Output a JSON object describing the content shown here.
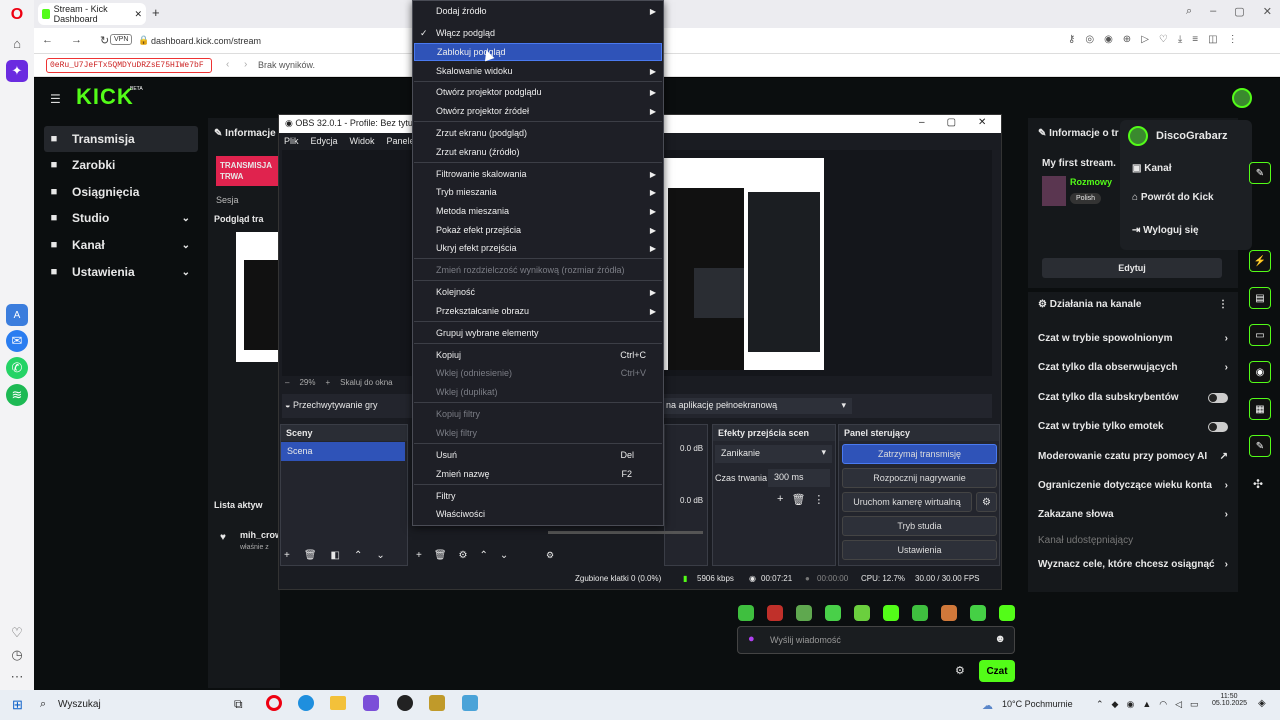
{
  "browser": {
    "tab_title": "Stream - Kick Dashboard",
    "url": "dashboard.kick.com/stream",
    "vpn": "VPN",
    "find_text": "0eRu_U7JeFTx5QMDYuDRZsE75HIWe7bF",
    "find_result": "Brak wyników."
  },
  "kick": {
    "logo": "KICK",
    "logo_badge": "BETA",
    "nav": [
      {
        "label": "Transmisja"
      },
      {
        "label": "Zarobki"
      },
      {
        "label": "Osiągnięcia"
      },
      {
        "label": "Studio"
      },
      {
        "label": "Kanał"
      },
      {
        "label": "Ustawienia"
      }
    ],
    "info_title": "Informacje",
    "live_badge": "TRANSMISJA TRWA",
    "session": "Sesja",
    "preview_title": "Podgląd tra",
    "activity_title": "Lista aktyw",
    "activity_user": "mih_crow",
    "activity_text": "właśnie z",
    "stream_info_title": "Informacje o tr",
    "stream_name": "My first stream.",
    "stream_tag_cat": "Rozmowy",
    "stream_lang": "Polish",
    "edit_btn": "Edytuj",
    "actions_title": "Działania na kanale",
    "actions": [
      {
        "label": "Czat w trybie spowolnionym",
        "kind": "arrow"
      },
      {
        "label": "Czat tylko dla obserwujących",
        "kind": "arrow"
      },
      {
        "label": "Czat tylko dla subskrybentów",
        "kind": "toggle"
      },
      {
        "label": "Czat w trybie tylko emotek",
        "kind": "toggle"
      },
      {
        "label": "Moderowanie czatu przy pomocy AI",
        "kind": "ext"
      },
      {
        "label": "Ograniczenie dotyczące wieku konta",
        "kind": "arrow"
      },
      {
        "label": "Zakazane słowa",
        "kind": "arrow"
      },
      {
        "label": "Kanał udostępniający",
        "kind": "none"
      },
      {
        "label": "Wyznacz cele, które chcesz osiągnąć",
        "kind": "arrow"
      }
    ],
    "user_menu": {
      "username": "DiscoGrabarz",
      "items": [
        "Kanał",
        "Powrót do Kick",
        "Wyloguj się"
      ]
    },
    "chat_placeholder": "Wyślij wiadomość",
    "chat_btn": "Czat"
  },
  "obs": {
    "title": "OBS 32.0.1 - Profile: Bez tytułu -",
    "menu": [
      "Plik",
      "Edycja",
      "Widok",
      "Panele"
    ],
    "zoom": "29%",
    "zoom_mode": "Skaluj do okna",
    "game_capture": "Przechwytywanie gry",
    "fullscreen_app": "na aplikację pełnoekranową",
    "scenes_title": "Sceny",
    "scene_item": "Scena",
    "transitions_title": "Efekty przejścia scen",
    "transition": "Zanikanie",
    "duration_label": "Czas trwania",
    "duration": "300 ms",
    "controls_title": "Panel sterujący",
    "controls": [
      "Zatrzymaj transmisję",
      "Rozpocznij nagrywanie",
      "Uruchom kamerę wirtualną",
      "Tryb studia",
      "Ustawienia"
    ],
    "audio_db1": "0.0 dB",
    "audio_db2": "0.0 dB",
    "status": {
      "dropped": "Zgubione klatki 0 (0.0%)",
      "kbps": "5906 kbps",
      "live_time": "00:07:21",
      "rec_time": "00:00:00",
      "cpu": "CPU: 12.7%",
      "fps": "30.00 / 30.00 FPS"
    }
  },
  "context_menu": [
    {
      "label": "Dodaj źródło",
      "arrow": true
    },
    {
      "label": "Włącz podgląd",
      "check": true
    },
    {
      "label": "Zablokuj podgląd",
      "hl": true
    },
    {
      "label": "Skalowanie widoku",
      "arrow": true
    },
    {
      "label": "Otwórz projektor podglądu",
      "arrow": true
    },
    {
      "label": "Otwórz projektor źródeł",
      "arrow": true
    },
    {
      "label": "Zrzut ekranu (podgląd)"
    },
    {
      "label": "Zrzut ekranu (źródło)"
    },
    {
      "label": "Filtrowanie skalowania",
      "arrow": true
    },
    {
      "label": "Tryb mieszania",
      "arrow": true
    },
    {
      "label": "Metoda mieszania",
      "arrow": true
    },
    {
      "label": "Pokaż efekt przejścia",
      "arrow": true
    },
    {
      "label": "Ukryj efekt przejścia",
      "arrow": true
    },
    {
      "label": "Zmień rozdzielczość wynikową (rozmiar źródła)",
      "dis": true
    },
    {
      "label": "Kolejność",
      "arrow": true
    },
    {
      "label": "Przekształcanie obrazu",
      "arrow": true
    },
    {
      "label": "Grupuj wybrane elementy"
    },
    {
      "label": "Kopiuj",
      "shortcut": "Ctrl+C"
    },
    {
      "label": "Wklej (odniesienie)",
      "shortcut": "Ctrl+V",
      "dis": true
    },
    {
      "label": "Wklej (duplikat)",
      "dis": true
    },
    {
      "label": "Kopiuj filtry",
      "dis": true
    },
    {
      "label": "Wklej filtry",
      "dis": true
    },
    {
      "label": "Usuń",
      "shortcut": "Del"
    },
    {
      "label": "Zmień nazwę",
      "shortcut": "F2"
    },
    {
      "label": "Filtry"
    },
    {
      "label": "Właściwości"
    }
  ],
  "taskbar": {
    "search": "Wyszukaj",
    "weather": "10°C Pochmurnie",
    "time": "11:50",
    "date": "05.10.2025"
  },
  "colors": {
    "kick_green": "#53fc18",
    "highlight": "#2f53b8",
    "live_red": "#e0234e"
  }
}
